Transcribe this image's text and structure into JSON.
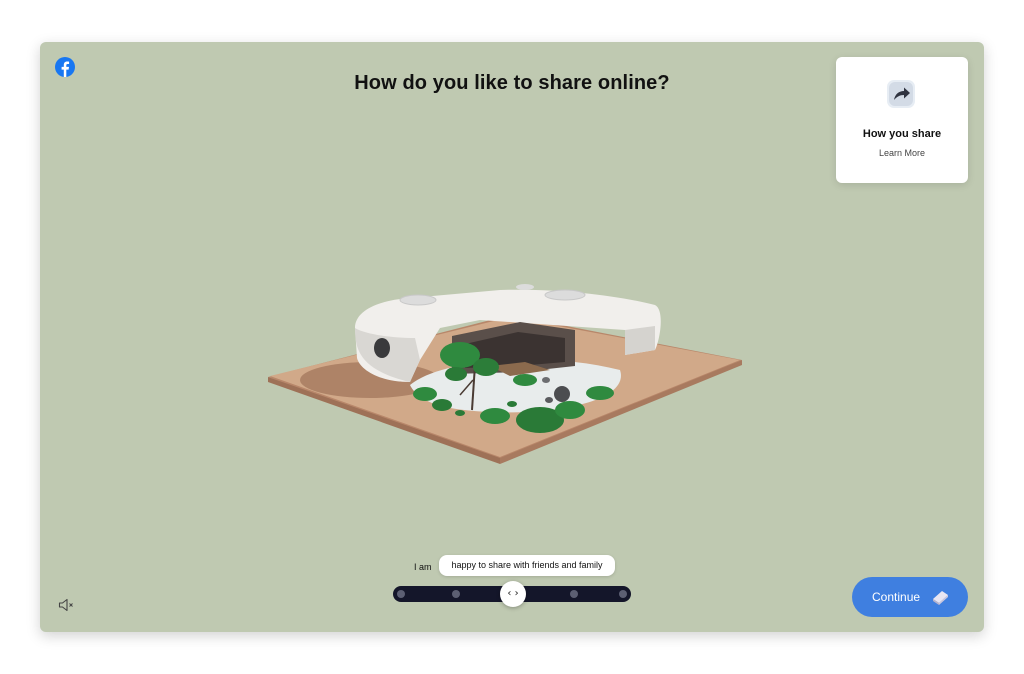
{
  "app": {
    "logo_icon": "facebook-logo-icon",
    "brand_color": "#1877f2"
  },
  "header": {
    "title": "How do you like to share online?"
  },
  "info_card": {
    "icon": "share-arrow-icon",
    "title": "How you share",
    "link": "Learn More"
  },
  "scene": {
    "description_icon": "house-garden-illustration"
  },
  "answer": {
    "prefix": "I am",
    "selected": "happy to share with friends and family"
  },
  "slider": {
    "stops": 5,
    "selected_stop": 3,
    "thumb_glyph": "‹ ›"
  },
  "footer": {
    "sound_icon": "speaker-muted-icon",
    "continue_label": "Continue",
    "continue_icon": "eraser-icon"
  },
  "colors": {
    "background": "#bfc9b1",
    "button": "#3f7fe0",
    "slider_track": "#14162a"
  }
}
